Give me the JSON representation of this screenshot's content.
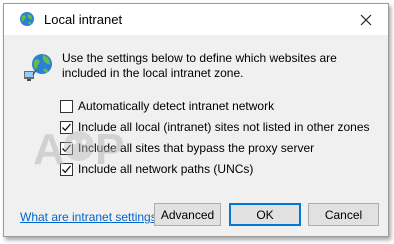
{
  "window": {
    "title": "Local intranet",
    "close_icon": "close-icon"
  },
  "description": "Use the settings below to define which websites are included in the local intranet zone.",
  "options": [
    {
      "label": "Automatically detect intranet network",
      "checked": false
    },
    {
      "label": "Include all local (intranet) sites not listed in other zones",
      "checked": true
    },
    {
      "label": "Include all sites that bypass the proxy server",
      "checked": true
    },
    {
      "label": "Include all network paths (UNCs)",
      "checked": true
    }
  ],
  "help_link": "What are intranet settings?",
  "buttons": {
    "advanced": "Advanced",
    "ok": "OK",
    "cancel": "Cancel"
  },
  "watermark": "A PPUALS",
  "colors": {
    "link": "#0066cc",
    "ok_border": "#0078d7",
    "body_bg": "#f0f0f0"
  }
}
